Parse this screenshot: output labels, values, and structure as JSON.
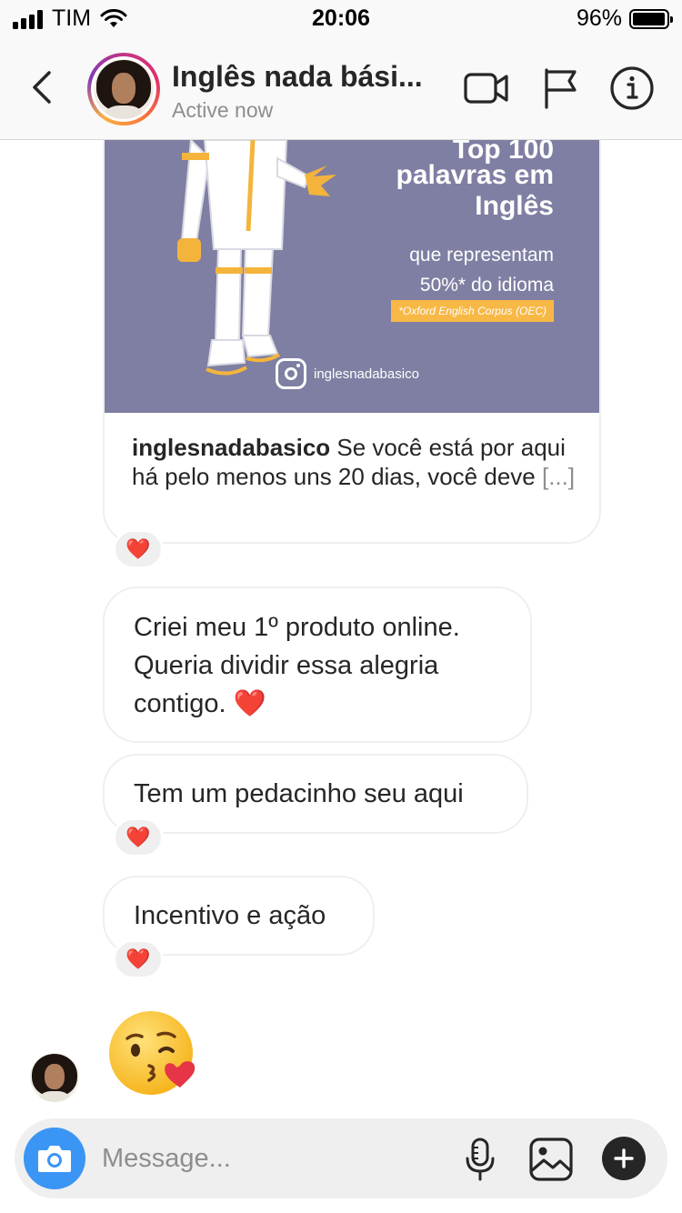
{
  "status_bar": {
    "carrier": "TIM",
    "time": "20:06",
    "battery_percent": "96%",
    "battery_level": 0.96
  },
  "header": {
    "name": "Inglês nada bási...",
    "status": "Active now",
    "icons": [
      "back-arrow-icon",
      "video-camera-icon",
      "flag-icon",
      "info-icon"
    ]
  },
  "post": {
    "image_title_line1": "Top 100",
    "image_title_line2": "palavras em",
    "image_title_line3": "Inglês",
    "image_subtitle_line1": "que representam",
    "image_subtitle_line2": "50%* do idioma",
    "image_tag": "*Oxford English Corpus (OEC)",
    "image_handle": "inglesnadabasico",
    "caption_user": "inglesnadabasico",
    "caption_text": " Se você está por aqui há pelo menos uns 20 dias, você deve ",
    "caption_more": "[...]",
    "reaction": "❤️"
  },
  "messages": [
    {
      "text": "Criei meu 1º produto online. Queria dividir essa alegria contigo. ❤️"
    },
    {
      "text": "Tem um pedacinho seu aqui",
      "reaction": "❤️"
    },
    {
      "text": "Incentivo e ação",
      "reaction": "❤️"
    }
  ],
  "last_emoji": "kissing-face-with-heart-emoji",
  "composer": {
    "placeholder": "Message...",
    "icons": [
      "camera-icon",
      "microphone-icon",
      "gallery-icon",
      "plus-icon"
    ]
  },
  "colors": {
    "accent_blue": "#3b95f5",
    "heart_red": "#ed4956",
    "post_bg": "#7f7fa3",
    "tag_yellow": "#f7b845"
  }
}
